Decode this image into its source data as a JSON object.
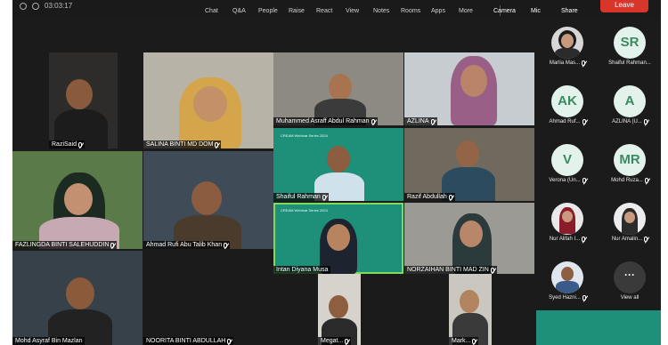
{
  "toolbar": {
    "timer": "03:03:17",
    "items": [
      "Chat",
      "Q&A",
      "People",
      "Raise",
      "React",
      "View",
      "Notes",
      "Rooms",
      "Apps",
      "More",
      "Camera",
      "Mic",
      "Share"
    ],
    "leave_label": "Leave"
  },
  "tiles": [
    {
      "name": "RaziSaid"
    },
    {
      "name": "SALINA BINTI MD DOM"
    },
    {
      "name": "Muhammed Asraff Abdul Rahman"
    },
    {
      "name": "AZLINA"
    },
    {
      "name": "FAZLINGDA BINTI SALEHUDDIN"
    },
    {
      "name": "Ahmad Rufi Abu Talib Khan"
    },
    {
      "name": "Shaiful Rahman",
      "banner": "CREAM Webinar Series 2024"
    },
    {
      "name": "Razif Abdullah"
    },
    {
      "name": "Intan Diyana Musa",
      "banner": "CREAM Webinar Series 2024"
    },
    {
      "name": "NORZAIHAN BINTI MAD ZIN"
    },
    {
      "name": "Mohd Asyraf Bin Mazlan"
    },
    {
      "name": "NOORITA BINTI ABDULLAH"
    },
    {
      "name": "Megat..."
    },
    {
      "name": "Mark..."
    }
  ],
  "sidebar": {
    "participants": [
      {
        "name": "Marlia Mas...",
        "initials": ""
      },
      {
        "name": "Shaiful Rahman...",
        "initials": "SR"
      },
      {
        "name": "Ahmad Ruf...",
        "initials": "AK"
      },
      {
        "name": "AZLINA (U...",
        "initials": "A"
      },
      {
        "name": "Verona (Un...",
        "initials": "V"
      },
      {
        "name": "Mohd Ruza...",
        "initials": "MR"
      },
      {
        "name": "Nur Alifah I...",
        "initials": ""
      },
      {
        "name": "Nur Amalin...",
        "initials": ""
      },
      {
        "name": "Syed Hazni...",
        "initials": ""
      }
    ],
    "view_all_label": "View all",
    "more_glyph": "···"
  },
  "colors": {
    "accent_green": "#1e8f78",
    "leave_red": "#d9362b",
    "speaker_outline": "#7fdc5a",
    "avatar_text": "#3c8a63"
  }
}
